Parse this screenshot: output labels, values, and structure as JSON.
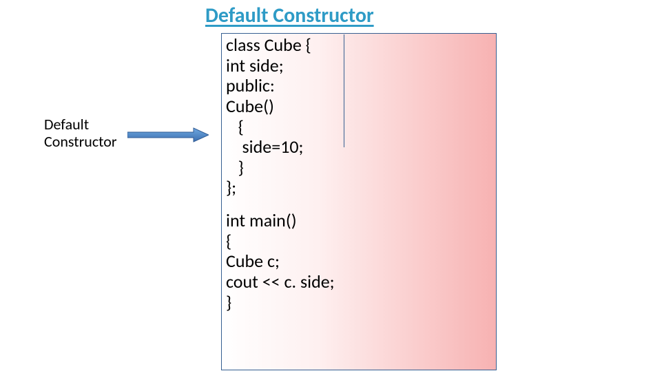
{
  "title": "Default Constructor",
  "label_line1": "Default",
  "label_line2": "Constructor",
  "code": {
    "l1": "class Cube {",
    "l2": "int side;",
    "l3": "public:",
    "l4": "Cube()",
    "l5": "   {",
    "l6": "    side=10;",
    "l7": "   }",
    "l8": "};",
    "l9": "int main()",
    "l10": "{",
    "l11": "Cube c;",
    "l12": "cout << c. side;",
    "l13": "}"
  }
}
